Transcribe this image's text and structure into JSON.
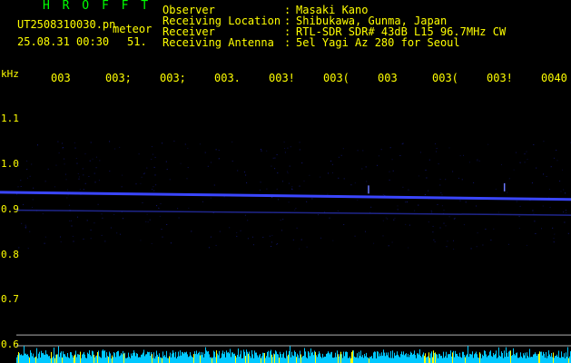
{
  "header": {
    "brand": "H R O F F T",
    "filename": "UT2508310030.pn",
    "tag": "meteor",
    "timestamp": "25.08.31 00:30",
    "frame_number": "51.",
    "fields": [
      {
        "label": "Observer",
        "colon": ":",
        "value": "Masaki Kano"
      },
      {
        "label": "Receiving Location",
        "colon": ":",
        "value": "Shibukawa, Gunma, Japan"
      },
      {
        "label": "Receiver",
        "colon": ":",
        "value": "RTL-SDR SDR# 43dB L15 96.7MHz CW"
      },
      {
        "label": "Receiving Antenna",
        "colon": ":",
        "value": "5el Yagi Az 280 for Seoul"
      }
    ]
  },
  "axis": {
    "unit": "kHz",
    "y_ticks": [
      "1.1",
      "1.0",
      "0.9",
      "0.8",
      "0.7",
      "0.6"
    ],
    "x_ticks": [
      "003",
      "003;",
      "003;",
      "003.",
      "003!",
      "003(",
      "003",
      "003(",
      "003!",
      "0040"
    ]
  },
  "colors": {
    "text": "#ffff00",
    "brand": "#00ff00",
    "trace": "#3a46ff",
    "baseline": "#b0b0b0",
    "noise": "#00c8ff",
    "noise_peak": "#ffff00"
  },
  "chart_data": {
    "type": "heatmap",
    "y_unit": "kHz",
    "y_ticks": [
      1.1,
      1.0,
      0.9,
      0.8,
      0.7,
      0.6
    ],
    "carrier_start_khz": 0.935,
    "carrier_end_khz": 0.919,
    "secondary_start_khz": 0.895,
    "secondary_end_khz": 0.884,
    "baseline_khz": 0.618,
    "pings": [
      {
        "position": 0.635,
        "khz": 0.94
      },
      {
        "position": 0.88,
        "khz": 0.945
      }
    ]
  }
}
